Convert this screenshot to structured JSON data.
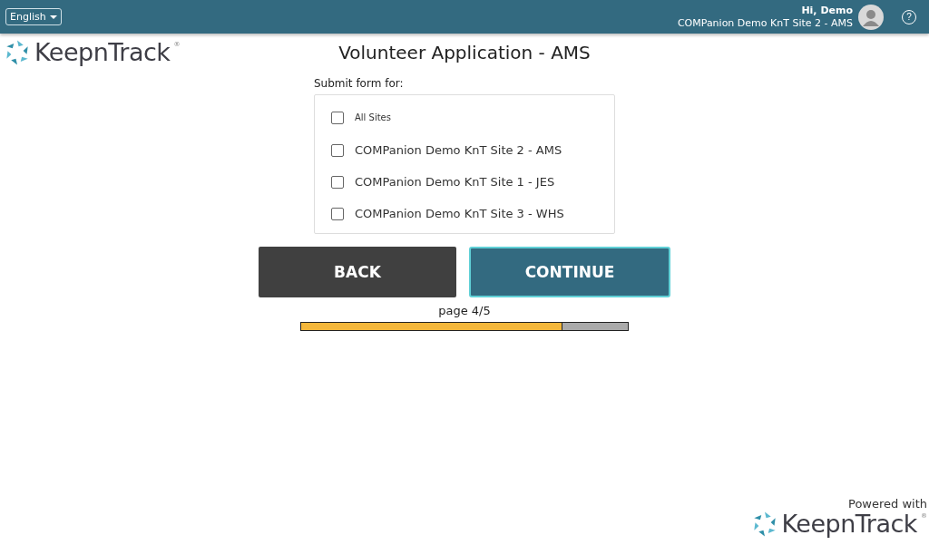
{
  "header": {
    "language": "English",
    "greeting": "Hi, Demo",
    "site": "COMPanion Demo KnT Site 2 - AMS",
    "help": "?"
  },
  "logo": {
    "name": "KeepnTrack",
    "mark": "®"
  },
  "title": "Volunteer Application - AMS",
  "form": {
    "label": "Submit form for:",
    "options": [
      {
        "label": "All Sites",
        "kind": "all",
        "checked": false
      },
      {
        "label": "COMPanion Demo KnT Site 2 - AMS",
        "kind": "site",
        "checked": false
      },
      {
        "label": "COMPanion Demo KnT Site 1 - JES",
        "kind": "site",
        "checked": false
      },
      {
        "label": "COMPanion Demo KnT Site 3 - WHS",
        "kind": "site",
        "checked": false
      }
    ]
  },
  "buttons": {
    "back": "BACK",
    "continue": "CONTINUE"
  },
  "progress": {
    "label": "page 4/5",
    "level": 0.8
  },
  "footer": {
    "powered": "Powered with",
    "logo": {
      "name": "KeepnTrack",
      "mark": "®"
    }
  }
}
